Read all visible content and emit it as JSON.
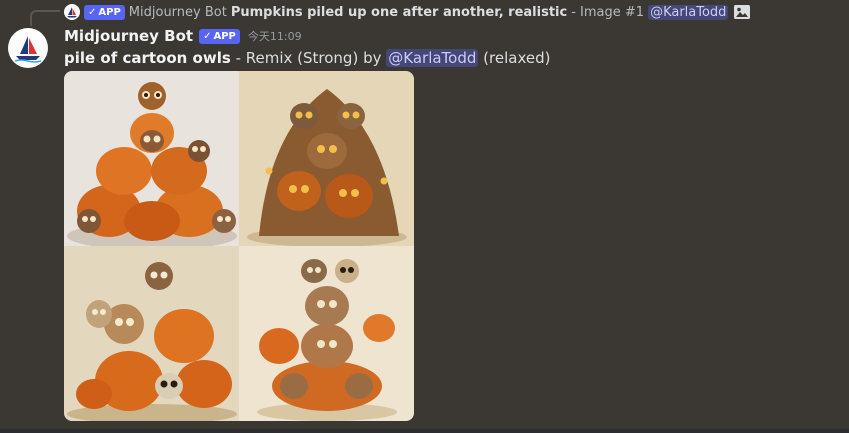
{
  "reply": {
    "bot_name": "Midjourney Bot",
    "app_badge": "APP",
    "prompt": "Pumpkins piled up one after another, realistic",
    "rest": "- Image #1",
    "mention": "@KarlaTodd",
    "icons": [
      "midjourney-avatar-icon",
      "checkmark-icon",
      "image-icon"
    ]
  },
  "header": {
    "author": "Midjourney Bot",
    "app_badge": "APP",
    "timestamp": "今天11:09"
  },
  "message": {
    "prompt": "pile of cartoon owls",
    "mode": "- Remix (Strong) by",
    "mention": "@KarlaTodd",
    "speed": "(relaxed)"
  },
  "image_grid": {
    "images": [
      {
        "label": "owl-pile-image-1"
      },
      {
        "label": "owl-pile-image-2"
      },
      {
        "label": "owl-pile-image-3"
      },
      {
        "label": "owl-pile-image-4"
      }
    ]
  },
  "colors": {
    "background": "#3b3833",
    "accent": "#5865f2",
    "mention_bg": "#4a4f8a",
    "pumpkin": "#d8661b"
  }
}
